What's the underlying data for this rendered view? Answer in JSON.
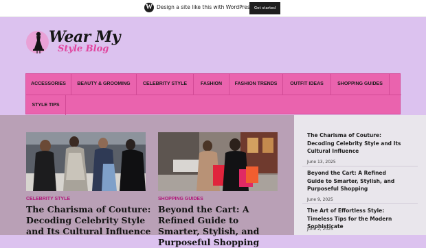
{
  "banner": {
    "logo_glyph": "W",
    "text": "Design a site like this with WordPress.com",
    "button": "Get started"
  },
  "header": {
    "logo_line1": "Wear My",
    "logo_line2": "Style Blog",
    "accent": "#e0459e"
  },
  "nav": {
    "items": [
      "ACCESSORIES",
      "BEAUTY & GROOMING",
      "CELEBRITY STYLE",
      "FASHION",
      "FASHION TRENDS",
      "OUTFIT IDEAS",
      "SHOPPING GUIDES",
      "STYLE TIPS"
    ],
    "background": "#ea63ae"
  },
  "posts": [
    {
      "category": "CELEBRITY STYLE",
      "title": "The Charisma of Couture: Decoding Celebrity Style and Its Cultural Influence"
    },
    {
      "category": "SHOPPING GUIDES",
      "title": "Beyond the Cart: A Refined Guide to Smarter, Stylish, and Purposeful Shopping"
    }
  ],
  "sidebar": {
    "posts": [
      {
        "title": "The Charisma of Couture: Decoding Celebrity Style and Its Cultural Influence",
        "date": "June 13, 2025"
      },
      {
        "title": "Beyond the Cart: A Refined Guide to Smarter, Stylish, and Purposeful Shopping",
        "date": "June 9, 2025"
      },
      {
        "title": "The Art of Effortless Style: Timeless Tips for the Modern Sophisticate",
        "date": "June 2, 2025"
      }
    ]
  }
}
